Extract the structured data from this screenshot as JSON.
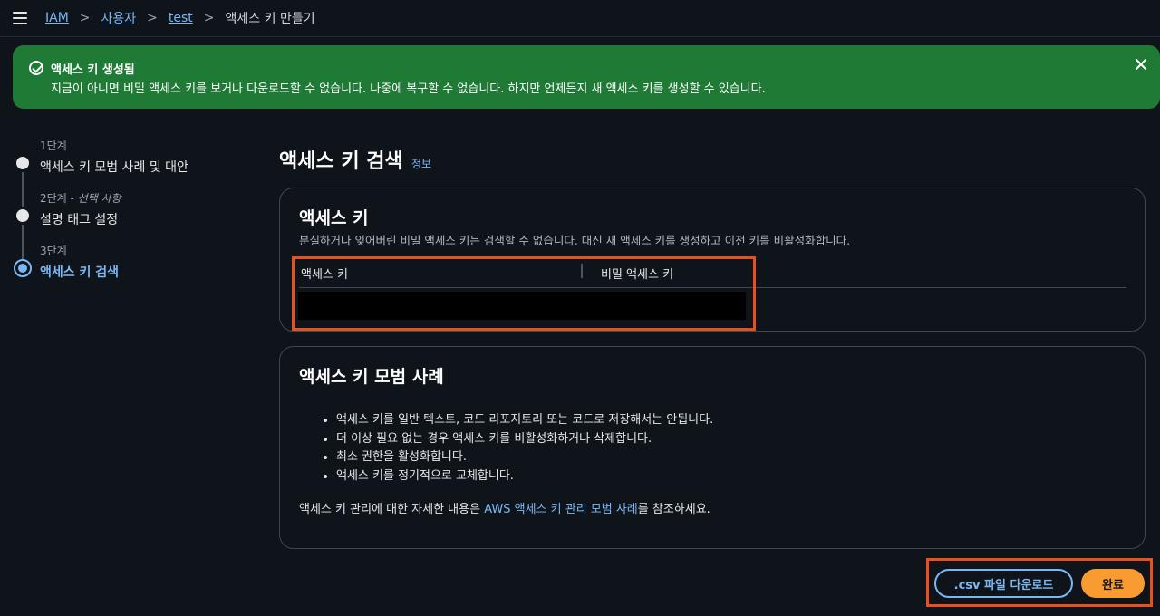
{
  "breadcrumb": {
    "items": [
      "IAM",
      "사용자",
      "test"
    ],
    "current": "액세스 키 만들기"
  },
  "flash": {
    "title": "액세스 키 생성됨",
    "message": "지금이 아니면 비밀 액세스 키를 보거나 다운로드할 수 없습니다. 나중에 복구할 수 없습니다. 하지만 언제든지 새 액세스 키를 생성할 수 있습니다."
  },
  "steps": [
    {
      "num": "1단계",
      "optional": "",
      "label": "액세스 키 모범 사례 및 대안"
    },
    {
      "num": "2단계 - ",
      "optional": "선택 사항",
      "label": "설명 태그 설정"
    },
    {
      "num": "3단계",
      "optional": "",
      "label": "액세스 키 검색"
    }
  ],
  "page": {
    "title": "액세스 키 검색",
    "info": "정보"
  },
  "access_key_card": {
    "title": "액세스 키",
    "description": "분실하거나 잊어버린 비밀 액세스 키는 검색할 수 없습니다. 대신 새 액세스 키를 생성하고 이전 키를 비활성화합니다.",
    "columns": [
      "액세스 키",
      "비밀 액세스 키"
    ]
  },
  "best_practices_card": {
    "title": "액세스 키 모범 사례",
    "bullets": [
      "액세스 키를 일반 텍스트, 코드 리포지토리 또는 코드로 저장해서는 안됩니다.",
      "더 이상 필요 없는 경우 액세스 키를 비활성화하거나 삭제합니다.",
      "최소 권한을 활성화합니다.",
      "액세스 키를 정기적으로 교체합니다."
    ],
    "note_prefix": "액세스 키 관리에 대한 자세한 내용은 ",
    "note_link": "AWS 액세스 키 관리 모범 사례",
    "note_suffix": "를 참조하세요."
  },
  "actions": {
    "csv_label": ".csv 파일 다운로드",
    "done_label": "완료"
  },
  "colors": {
    "flash_bg": "#1e7a34",
    "link": "#7ab8f5",
    "primary": "#f89b30",
    "highlight": "#e8501e"
  }
}
